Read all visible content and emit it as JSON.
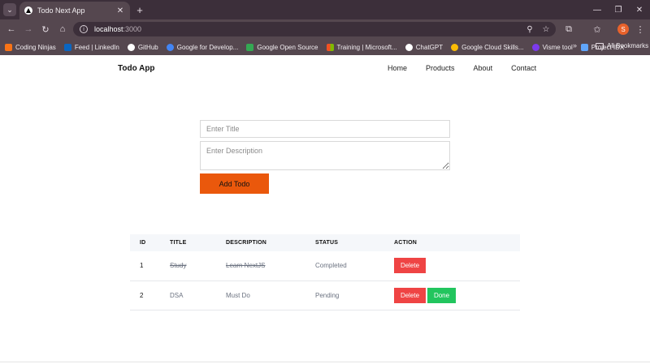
{
  "browser": {
    "tab": {
      "title": "Todo Next App",
      "favicon": "nextjs-triangle-icon"
    },
    "url": {
      "host": "localhost",
      "port": ":3000"
    },
    "bookmarks": [
      {
        "label": "Coding Ninjas",
        "icon_color": "#f97316"
      },
      {
        "label": "Feed | LinkedIn",
        "icon_color": "#0a66c2"
      },
      {
        "label": "GitHub",
        "icon_color": "#ffffff"
      },
      {
        "label": "Google for Develop...",
        "icon_color": "#4285f4"
      },
      {
        "label": "Google Open Source",
        "icon_color": "#34a853"
      },
      {
        "label": "Training | Microsoft...",
        "icon_color": "#f25022"
      },
      {
        "label": "ChatGPT",
        "icon_color": "#ffffff"
      },
      {
        "label": "Google Cloud Skills...",
        "icon_color": "#fbbc05"
      },
      {
        "label": "Visme tool",
        "icon_color": "#7c3aed"
      },
      {
        "label": "Project IDX",
        "icon_color": "#60a5fa"
      }
    ],
    "bookmarks_more": "»",
    "all_bookmarks": "All Bookmarks",
    "profile_initial": "S"
  },
  "nav": {
    "brand": "Todo App",
    "links": [
      "Home",
      "Products",
      "About",
      "Contact"
    ]
  },
  "form": {
    "title_placeholder": "Enter Title",
    "description_placeholder": "Enter Description",
    "submit_label": "Add Todo"
  },
  "table": {
    "headers": [
      "ID",
      "TITLE",
      "DESCRIPTION",
      "STATUS",
      "ACTION"
    ],
    "rows": [
      {
        "id": "1",
        "title": "Study",
        "description": "Learn NextJS",
        "status": "Completed",
        "completed": true,
        "actions": [
          "Delete"
        ]
      },
      {
        "id": "2",
        "title": "DSA",
        "description": "Must Do",
        "status": "Pending",
        "completed": false,
        "actions": [
          "Delete",
          "Done"
        ]
      }
    ]
  },
  "colors": {
    "accent": "#ea580c",
    "delete": "#ef4444",
    "done": "#22c55e"
  }
}
